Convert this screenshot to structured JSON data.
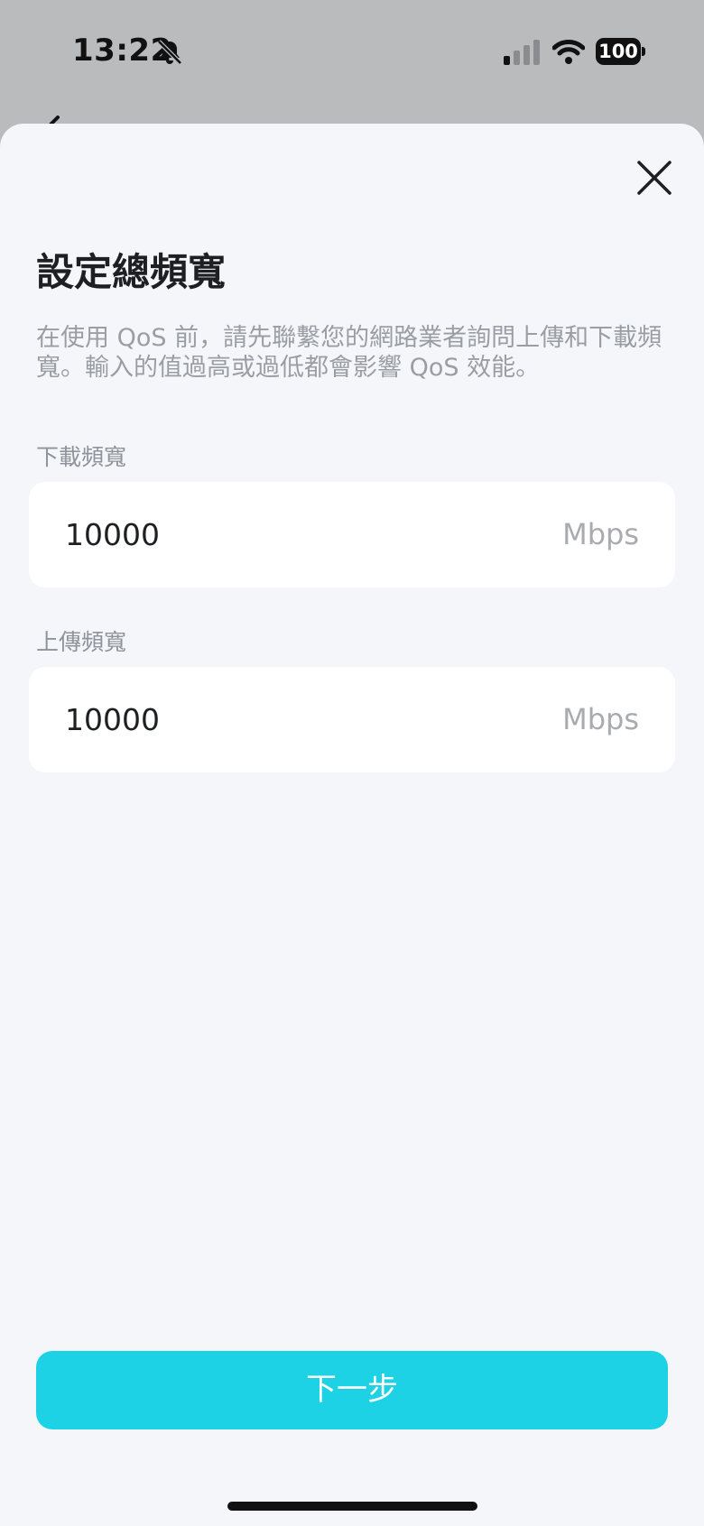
{
  "status_bar": {
    "time": "13:22",
    "icons": [
      "bell-slash-icon",
      "cellular-signal-icon",
      "wifi-icon",
      "battery-icon"
    ],
    "battery_level": "100"
  },
  "sheet": {
    "close_icon": "close-icon",
    "title": "設定總頻寬",
    "description": "在使用 QoS 前，請先聯繫您的網路業者詢問上傳和下載頻寬。輸入的值過高或過低都會影響 QoS 效能。",
    "download": {
      "label": "下載頻寬",
      "value": "10000",
      "unit": "Mbps"
    },
    "upload": {
      "label": "上傳頻寬",
      "value": "10000",
      "unit": "Mbps"
    },
    "next_button": "下一步"
  },
  "colors": {
    "accent": "#1ed2e6",
    "sheet_background": "#f4f6fa",
    "field_background": "#ffffff",
    "muted_text": "#9a9ea4"
  }
}
